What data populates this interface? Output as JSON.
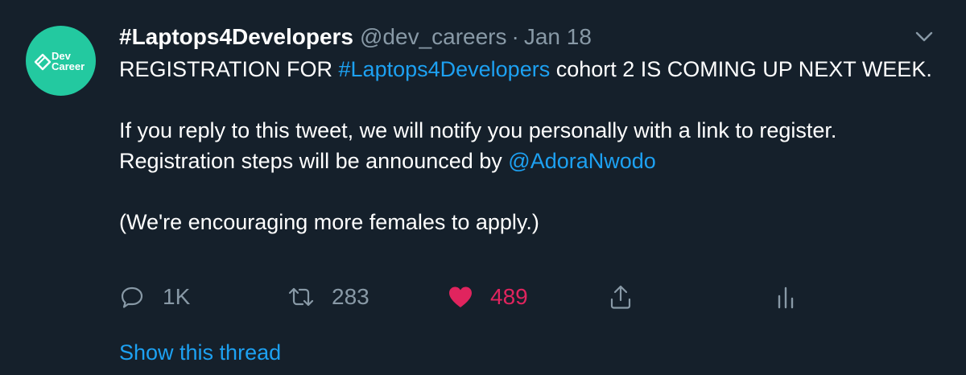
{
  "theme": {
    "background": "#15202b",
    "text": "#ffffff",
    "muted": "#8899a6",
    "link": "#1da1f2",
    "like": "#e0245e",
    "avatar_bg": "#23c9a0"
  },
  "tweet": {
    "avatar": {
      "icon": "dev-career-logo",
      "line1": "Dev",
      "line2": "Career"
    },
    "display_name": "#Laptops4Developers",
    "handle": "@dev_careers",
    "separator": "·",
    "date": "Jan 18",
    "body": {
      "p1_prefix": "REGISTRATION FOR ",
      "p1_hashtag": "#Laptops4Developers",
      "p1_suffix": " cohort 2  IS COMING UP NEXT WEEK.",
      "p2_line1": "If you reply to this tweet, we will notify you personally with a link to register.",
      "p2_line2_prefix": "Registration steps will be announced by ",
      "p2_mention": "@AdoraNwodo",
      "p3": "(We're encouraging more females to apply.)"
    },
    "actions": {
      "reply": {
        "icon": "reply-icon",
        "count": "1K"
      },
      "retweet": {
        "icon": "retweet-icon",
        "count": "283"
      },
      "like": {
        "icon": "heart-icon",
        "count": "489",
        "liked": true
      },
      "share": {
        "icon": "share-icon"
      },
      "analytics": {
        "icon": "analytics-icon"
      }
    },
    "show_thread": "Show this thread"
  }
}
